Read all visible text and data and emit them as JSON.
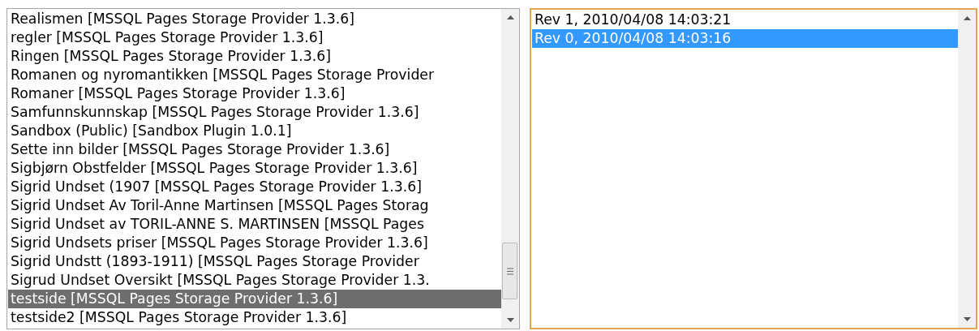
{
  "pages_list": {
    "focused": false,
    "items": [
      {
        "label": "Realismen [MSSQL Pages Storage Provider 1.3.6]",
        "selected": false
      },
      {
        "label": "regler [MSSQL Pages Storage Provider 1.3.6]",
        "selected": false
      },
      {
        "label": "Ringen [MSSQL Pages Storage Provider 1.3.6]",
        "selected": false
      },
      {
        "label": "Romanen og nyromantikken [MSSQL Pages Storage Provider",
        "selected": false
      },
      {
        "label": "Romaner [MSSQL Pages Storage Provider 1.3.6]",
        "selected": false
      },
      {
        "label": "Samfunnskunnskap [MSSQL Pages Storage Provider 1.3.6]",
        "selected": false
      },
      {
        "label": "Sandbox (Public) [Sandbox Plugin 1.0.1]",
        "selected": false
      },
      {
        "label": "Sette inn bilder [MSSQL Pages Storage Provider 1.3.6]",
        "selected": false
      },
      {
        "label": "Sigbjørn Obstfelder [MSSQL Pages Storage Provider 1.3.6]",
        "selected": false
      },
      {
        "label": "Sigrid Undset (1907 [MSSQL Pages Storage Provider 1.3.6]",
        "selected": false
      },
      {
        "label": "Sigrid Undset Av Toril-Anne Martinsen [MSSQL Pages Storag",
        "selected": false
      },
      {
        "label": "Sigrid Undset av TORIL-ANNE S. MARTINSEN [MSSQL Pages",
        "selected": false
      },
      {
        "label": "Sigrid Undsets priser [MSSQL Pages Storage Provider 1.3.6]",
        "selected": false
      },
      {
        "label": "Sigrid Undstt (1893-1911) [MSSQL Pages Storage Provider",
        "selected": false
      },
      {
        "label": "Sigrud Undset Oversikt [MSSQL Pages Storage Provider 1.3.",
        "selected": false
      },
      {
        "label": "testside [MSSQL Pages Storage Provider 1.3.6]",
        "selected": true
      },
      {
        "label": "testside2 [MSSQL Pages Storage Provider 1.3.6]",
        "selected": false
      }
    ]
  },
  "revisions_list": {
    "focused": true,
    "items": [
      {
        "label": "Rev 1, 2010/04/08 14:03:21",
        "selected": false
      },
      {
        "label": "Rev 0, 2010/04/08 14:03:16",
        "selected": true
      }
    ]
  }
}
